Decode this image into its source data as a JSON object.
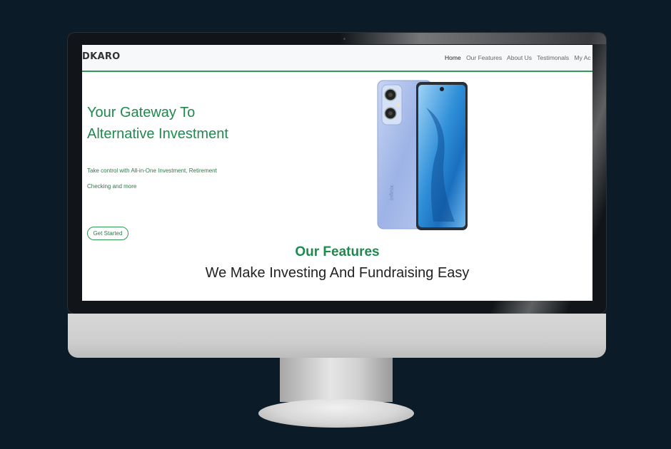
{
  "navbar": {
    "brand": "DKARO",
    "links": [
      {
        "label": "Home",
        "active": true
      },
      {
        "label": "Our Features",
        "active": false
      },
      {
        "label": "About Us",
        "active": false
      },
      {
        "label": "Testimonals",
        "active": false
      },
      {
        "label": "My Ac",
        "active": false
      }
    ]
  },
  "hero": {
    "title": "Your Gateway To Alternative Investment",
    "subtitle_line1": "Take control with All-in-One Investment, Retirement",
    "subtitle_line2": "Checking and more",
    "cta_label": "Get Started",
    "phone_brand_text": "infinix"
  },
  "features": {
    "heading": "Our Features",
    "subheading": "We Make Investing And Fundraising Easy"
  },
  "colors": {
    "accent": "#1e8a4d",
    "nav_border": "#2e9a52",
    "background": "#0b1c28"
  }
}
